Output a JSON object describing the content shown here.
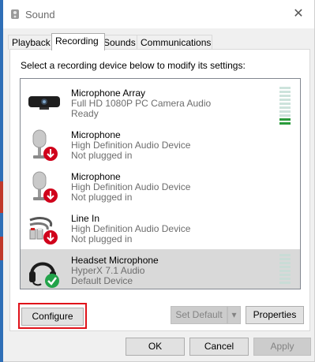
{
  "window": {
    "title": "Sound",
    "close_label": "✕"
  },
  "tabs": [
    {
      "label": "Playback"
    },
    {
      "label": "Recording"
    },
    {
      "label": "Sounds"
    },
    {
      "label": "Communications"
    }
  ],
  "instruction": "Select a recording device below to modify its settings:",
  "devices": [
    {
      "name": "Microphone Array",
      "description": "Full HD 1080P PC Camera Audio",
      "status": "Ready",
      "icon": "camera-icon",
      "level_on_segments": 2
    },
    {
      "name": "Microphone",
      "description": "High Definition Audio Device",
      "status": "Not plugged in",
      "icon": "microphone-icon"
    },
    {
      "name": "Microphone",
      "description": "High Definition Audio Device",
      "status": "Not plugged in",
      "icon": "microphone-icon"
    },
    {
      "name": "Line In",
      "description": "High Definition Audio Device",
      "status": "Not plugged in",
      "icon": "line-in-icon"
    },
    {
      "name": "Headset Microphone",
      "description": "HyperX 7.1 Audio",
      "status": "Default Device",
      "icon": "headset-icon",
      "selected": true
    }
  ],
  "buttons": {
    "configure": "Configure",
    "set_default": "Set Default",
    "properties": "Properties",
    "ok": "OK",
    "cancel": "Cancel",
    "apply": "Apply"
  },
  "colors": {
    "highlight_outline": "#e0121a",
    "level_on": "#2a9b3c",
    "selected_row": "#d9d9d9"
  }
}
